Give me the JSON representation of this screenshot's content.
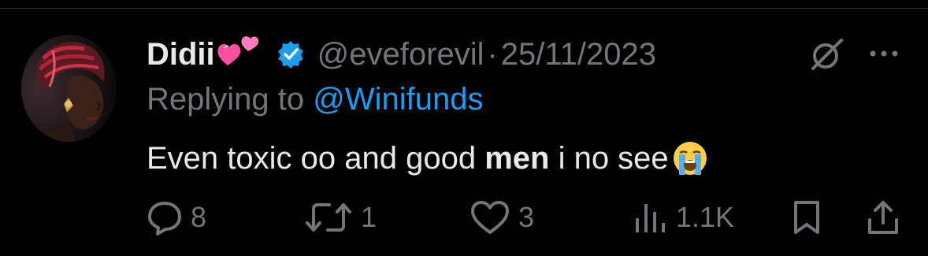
{
  "tweet": {
    "display_name": "Didii",
    "name_emoji": "two-hearts",
    "verified": true,
    "handle": "@eveforevil",
    "separator": "·",
    "date": "25/11/2023",
    "replying_label": "Replying to",
    "replying_to": "@Winifunds",
    "text_part1": "Even toxic oo and good ",
    "text_bold": "men",
    "text_part2": " i no see",
    "text_emoji": "loudly-crying-face"
  },
  "actions": {
    "replies": "8",
    "retweets": "1",
    "likes": "3",
    "views": "1.1K"
  },
  "colors": {
    "background": "#000000",
    "text": "#e7e9ea",
    "secondary": "#71767b",
    "accent": "#1d9bf0",
    "verified": "#1d9bf0"
  },
  "icons": [
    "grok-icon",
    "more-icon",
    "reply-icon",
    "retweet-icon",
    "like-icon",
    "views-icon",
    "bookmark-icon",
    "share-icon"
  ]
}
